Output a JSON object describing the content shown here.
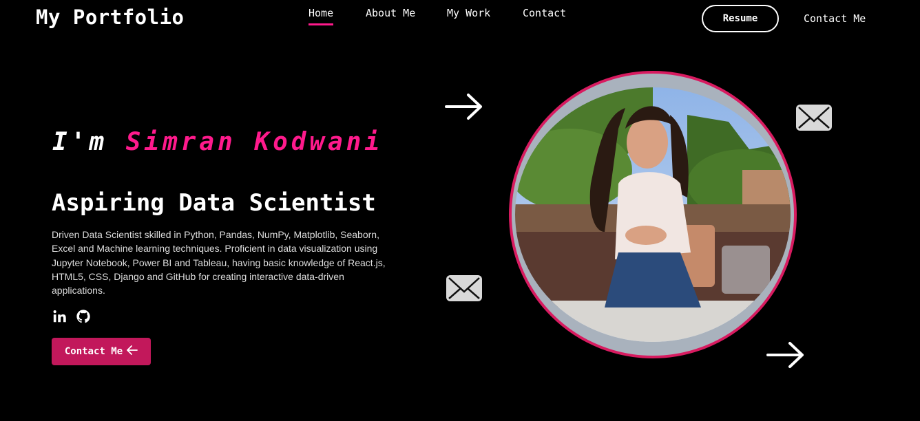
{
  "header": {
    "brand": "My Portfolio",
    "nav": [
      "Home",
      "About Me",
      "My Work",
      "Contact"
    ],
    "active_nav": "Home",
    "resume_label": "Resume",
    "contact_label": "Contact Me"
  },
  "hero": {
    "greeting_prefix": "I'm",
    "name": "Simran Kodwani",
    "role": "Aspiring Data Scientist",
    "description": "Driven Data Scientist skilled in Python, Pandas, NumPy, Matplotlib, Seaborn, Excel and Machine learning techniques. Proficient in data visualization using Jupyter Notebook, Power BI and Tableau, having basic knowledge of React.js, HTML5, CSS, Django and GitHub for creating interactive data-driven applications.",
    "cta_label": "Contact Me",
    "social_icons": [
      "linkedin-icon",
      "github-icon"
    ]
  },
  "colors": {
    "accent": "#ff1a8c",
    "button": "#c2185b",
    "background": "#000000"
  }
}
